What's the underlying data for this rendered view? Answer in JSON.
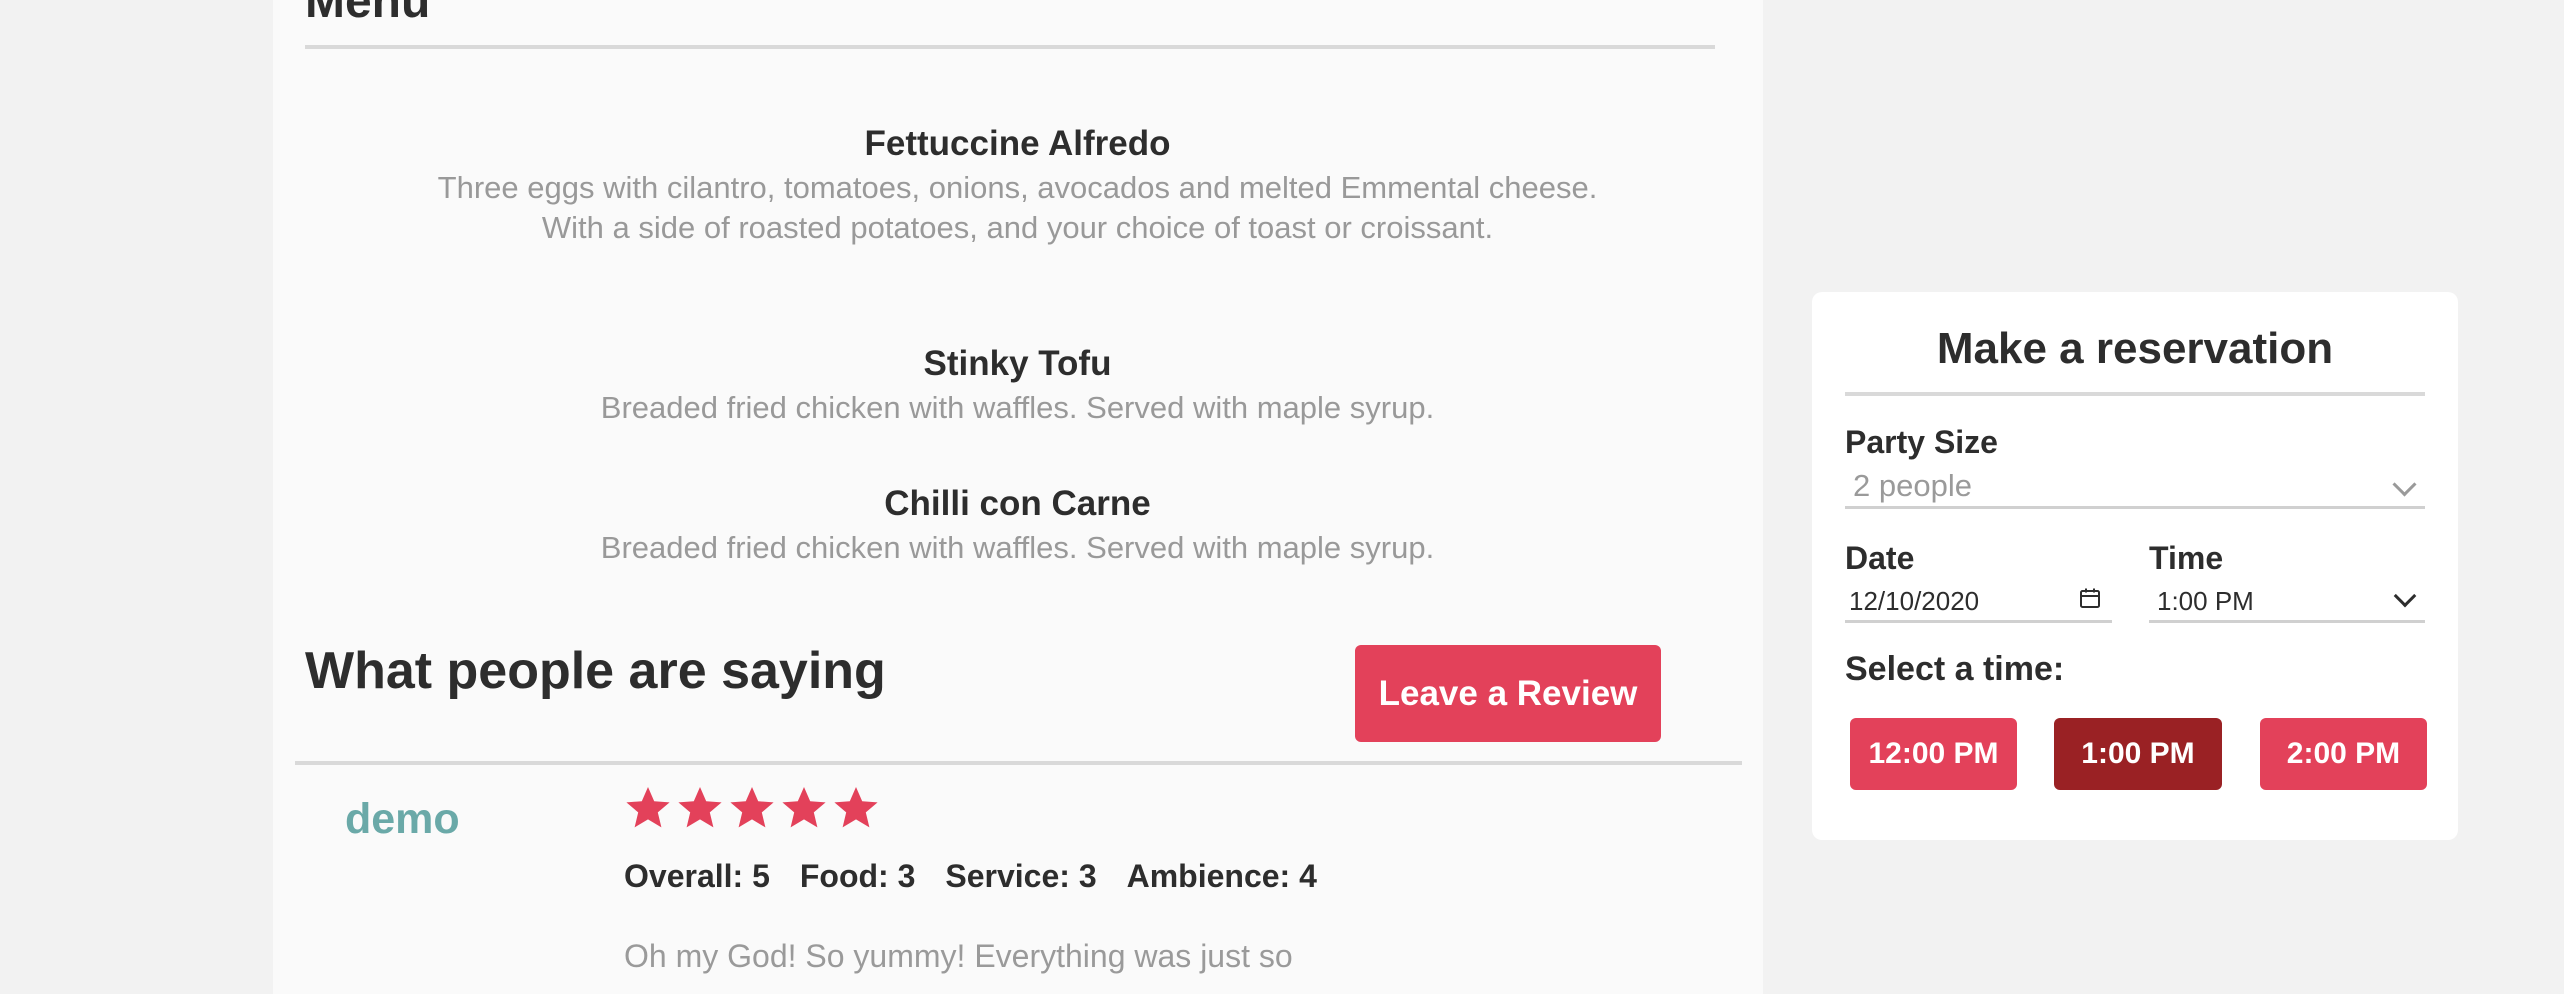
{
  "menu": {
    "heading": "Menu",
    "items": [
      {
        "name": "Fettuccine Alfredo",
        "description": "Three eggs with cilantro, tomatoes, onions, avocados and melted Emmental cheese. With a side of roasted potatoes, and your choice of toast or croissant."
      },
      {
        "name": "Stinky Tofu",
        "description": "Breaded fried chicken with waffles. Served with maple syrup."
      },
      {
        "name": "Chilli con Carne",
        "description": "Breaded fried chicken with waffles. Served with maple syrup."
      }
    ]
  },
  "reviews": {
    "heading": "What people are saying",
    "leave_review_label": "Leave a Review",
    "items": [
      {
        "reviewer": "demo",
        "rating": 5,
        "scores": {
          "overall": "Overall: 5",
          "food": "Food: 3",
          "service": "Service: 3",
          "ambience": "Ambience: 4"
        },
        "text": "Oh my God! So yummy! Everything was just so"
      }
    ]
  },
  "reservation": {
    "title": "Make a reservation",
    "party_size_label": "Party Size",
    "party_size_value": "2 people",
    "date_label": "Date",
    "date_value": "12/10/2020",
    "time_label": "Time",
    "time_value": "1:00 PM",
    "select_time_label": "Select a time:",
    "time_slots": [
      "12:00 PM",
      "1:00 PM",
      "2:00 PM"
    ],
    "selected_slot": "1:00 PM"
  },
  "colors": {
    "accent": "#e3415a",
    "accent_selected": "#9a2124",
    "reviewer_name": "#6aa9a8",
    "muted_text": "#999999"
  }
}
